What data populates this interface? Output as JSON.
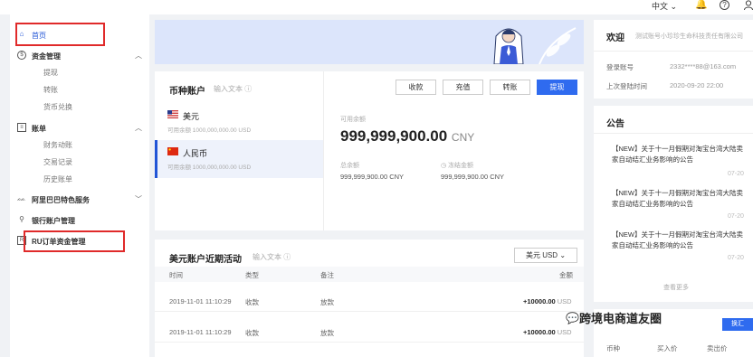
{
  "topbar": {
    "lang": "中文",
    "lang_chevron": "⌄",
    "bell_icon": "🔔",
    "help_icon": "?",
    "user_icon": "ᴙ"
  },
  "sidebar": {
    "home": "首页",
    "funds": "资金管理",
    "funds_sub": [
      "提现",
      "转账",
      "货币兑换"
    ],
    "bills": "账单",
    "bills_sub": [
      "财务动账",
      "交易记录",
      "历史账单"
    ],
    "alibaba": "阿里巴巴特色服务",
    "bank": "银行账户管理",
    "ru": "RU订单资金管理"
  },
  "account": {
    "title": "币种账户",
    "placeholder": "输入文本",
    "buttons": [
      "收款",
      "充值",
      "转账",
      "提现"
    ],
    "currencies": [
      {
        "name": "美元",
        "sub": "可用余额 1000,000,000.00 USD"
      },
      {
        "name": "人民币",
        "sub": "可用余额 1000,000,000.00 USD"
      }
    ],
    "available_label": "可用余额",
    "available_value": "999,999,900.00",
    "available_unit": "CNY",
    "total_label": "总余额",
    "total_value": "999,999,900.00 CNY",
    "frozen_label": "冻结金额",
    "frozen_value": "999,999,900.00 CNY"
  },
  "activity": {
    "title": "美元账户近期活动",
    "placeholder": "输入文本",
    "select": "美元 USD",
    "headers": [
      "时间",
      "类型",
      "备注",
      "金额"
    ],
    "rows": [
      {
        "time": "2019-11-01 11:10:29",
        "type": "收款",
        "note": "放款",
        "amount": "+10000.00",
        "unit": "USD"
      },
      {
        "time": "2019-11-01 11:10:29",
        "type": "收款",
        "note": "放款",
        "amount": "+10000.00",
        "unit": "USD"
      }
    ]
  },
  "welcome": {
    "title": "欢迎",
    "company": "测试账号小珍珍生命科技责任有限公司",
    "login_label": "登录账号",
    "login_value": "2332****88@163.com",
    "last_label": "上次登陆时间",
    "last_value": "2020-09-20 22:00"
  },
  "notice": {
    "title": "公告",
    "items": [
      {
        "text": "【NEW】关于十一月假期对淘宝台湾大陆卖家自动结汇业务影响的公告",
        "date": "07-20"
      },
      {
        "text": "【NEW】关于十一月假期对淘宝台湾大陆卖家自动结汇业务影响的公告",
        "date": "07-20"
      },
      {
        "text": "【NEW】关于十一月假期对淘宝台湾大陆卖家自动结汇业务影响的公告",
        "date": "07-20"
      }
    ],
    "more": "查看更多"
  },
  "fx": {
    "button": "换汇",
    "headers": [
      "币种",
      "买入价",
      "卖出价"
    ]
  },
  "watermark": "跨境电商道友圈",
  "colors": {
    "accent": "#2f6bef",
    "highlight_box": "#e02a2a"
  }
}
